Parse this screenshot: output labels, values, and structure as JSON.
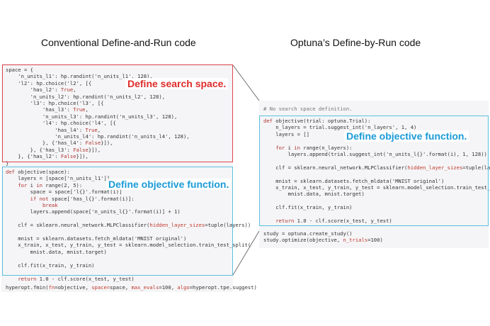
{
  "titles": {
    "left": "Conventional Define-and-Run code",
    "right": "Optuna’s Define-by-Run code"
  },
  "labels": {
    "search_space": "Define search space.",
    "objective_left": "Define objective function.",
    "objective_right": "Define objective function."
  },
  "colors": {
    "search_space_border": "#e0454a",
    "search_space_label": "#e02b2b",
    "objective_border": "#5bc0de",
    "objective_label": "#1a9bd7",
    "connector_lines": "#555555"
  },
  "code": {
    "left_space": [
      "space = {",
      "    'n_units_l1': hp.randint('n_units_l1', 128),",
      "    'l2': hp.choice('l2', [{",
      "        'has_l2': True,",
      "        'n_units_l2': hp.randint('n_units_l2', 128),",
      "        'l3': hp.choice('l3', [{",
      "            'has_l3': True,",
      "            'n_units_l3': hp.randint('n_units_l3', 128),",
      "            'l4': hp.choice('l4', [{",
      "                'has_l4': True,",
      "                'n_units_l4': hp.randint('n_units_l4', 128),",
      "            }, {'has_l4': False}]),",
      "        }, {'has_l3': False}]),",
      "    }, {'has_l2': False}]),",
      "}"
    ],
    "left_objective": [
      "def objective(space):",
      "    layers = [space['n_units_l1']]",
      "    for i in range(2, 5):",
      "        space = space['l{}'.format(i)]",
      "        if not space['has_l{}'.format(i)]:",
      "            break",
      "        layers.append(space['n_units_l{}'.format(i)] + 1)",
      "",
      "    clf = sklearn.neural_network.MLPClassifier(hidden_layer_sizes=tuple(layers))",
      "",
      "    mnist = sklearn.datasets.fetch_mldata('MNIST original')",
      "    x_train, x_test, y_train, y_test = sklearn.model_selection.train_test_split(",
      "        mnist.data, mnist.target)",
      "",
      "    clf.fit(x_train, y_train)",
      "",
      "    return 1.0 - clf.score(x_test, y_test)"
    ],
    "left_call": "hyperopt.fmin(fn=objective, space=space, max_evals=100, algo=hyperopt.tpe.suggest)",
    "right_comment": "# No search space definition.",
    "right_objective": [
      "def objective(trial: optuna.Trial):",
      "    n_layers = trial.suggest_int('n_layers', 1, 4)",
      "    layers = []",
      "",
      "    for i in range(n_layers):",
      "        layers.append(trial.suggest_int('n_units_l{}'.format(i), 1, 128))",
      "",
      "    clf = sklearn.neural_network.MLPClassifier(hidden_layer_sizes=tuple(layers))",
      "",
      "    mnist = sklearn.datasets.fetch_mldata('MNIST original')",
      "    x_train, x_test, y_train, y_test = sklearn.model_selection.train_test_split(",
      "        mnist.data, mnist.target)",
      "",
      "    clf.fit(x_train, y_train)",
      "",
      "    return 1.0 - clf.score(x_test, y_test)"
    ],
    "right_study": [
      "study = optuna.create_study()",
      "study.optimize(objective, n_trials=100)"
    ]
  }
}
